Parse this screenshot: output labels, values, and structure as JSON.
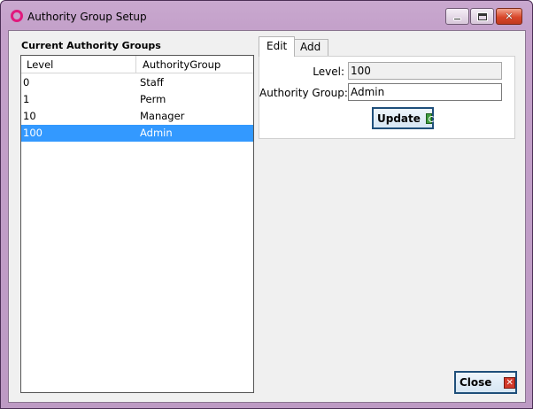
{
  "window": {
    "title": "Authority Group Setup",
    "icons": {
      "app": "app-ring-icon",
      "minimize": "minimize-icon",
      "maximize": "maximize-icon",
      "close": "close-icon"
    }
  },
  "groups": {
    "label": "Current Authority Groups",
    "columns": [
      "Level",
      "AuthorityGroup"
    ],
    "rows": [
      {
        "level": "0",
        "group": "Staff"
      },
      {
        "level": "1",
        "group": "Perm"
      },
      {
        "level": "10",
        "group": "Manager"
      },
      {
        "level": "100",
        "group": "Admin"
      }
    ],
    "selected_index": 3
  },
  "tabs": {
    "items": [
      "Edit",
      "Add"
    ],
    "active": "Edit"
  },
  "edit": {
    "level_label": "Level:",
    "level_value": "100",
    "group_label": "Authority Group:",
    "group_value": "Admin",
    "update_label": "Update",
    "update_icon": "refresh-icon"
  },
  "footer": {
    "close_label": "Close",
    "close_icon": "close-x-icon"
  },
  "colors": {
    "selection": "#3399ff",
    "titlebar": "#c4a1ca",
    "app_icon": "#e0197d",
    "close_button": "#d9472a"
  }
}
